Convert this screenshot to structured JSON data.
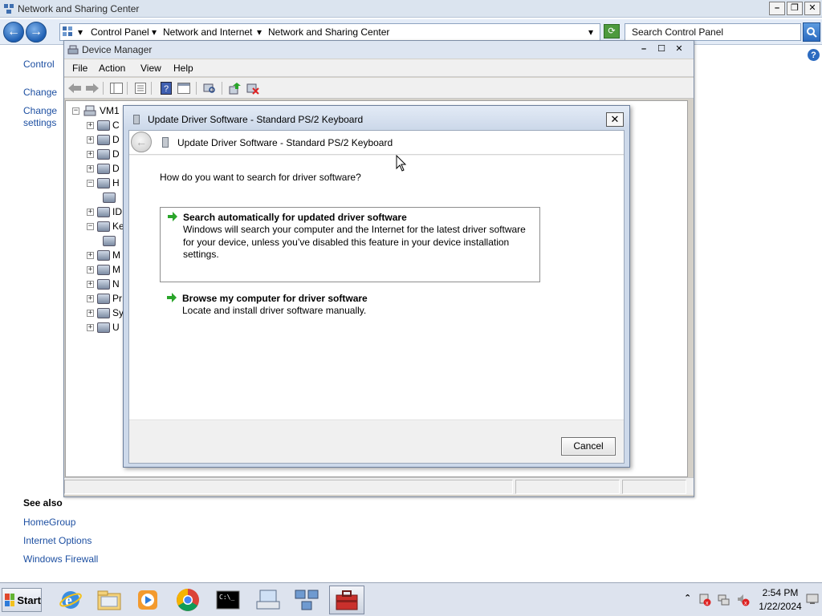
{
  "background_window": {
    "title": "Network and Sharing Center",
    "address_crumbs": [
      "Control Panel",
      "Network and Internet",
      "Network and Sharing Center"
    ],
    "search_placeholder": "Search Control Panel",
    "left_links": [
      "Control",
      "Change",
      "Change",
      "settings"
    ],
    "see_also_title": "See also",
    "see_also_links": [
      "HomeGroup",
      "Internet Options",
      "Windows Firewall"
    ]
  },
  "device_manager": {
    "title": "Device Manager",
    "menu": [
      "File",
      "Action",
      "View",
      "Help"
    ],
    "tree_root": "VM1",
    "tree_items": [
      {
        "label": "C",
        "expander": "+"
      },
      {
        "label": "D",
        "expander": "+"
      },
      {
        "label": "D",
        "expander": "+"
      },
      {
        "label": "D",
        "expander": "+"
      },
      {
        "label": "H",
        "expander": "-"
      },
      {
        "label": "",
        "expander": ""
      },
      {
        "label": "ID",
        "expander": "+"
      },
      {
        "label": "Ke",
        "expander": "-"
      },
      {
        "label": "",
        "expander": ""
      },
      {
        "label": "M",
        "expander": "+"
      },
      {
        "label": "M",
        "expander": "+"
      },
      {
        "label": "N",
        "expander": "+"
      },
      {
        "label": "Pr",
        "expander": "+"
      },
      {
        "label": "Sy",
        "expander": "+"
      },
      {
        "label": "U",
        "expander": "+"
      }
    ]
  },
  "update_dialog": {
    "title": "Update Driver Software - Standard PS/2 Keyboard",
    "header_title": "Update Driver Software - Standard PS/2 Keyboard",
    "question": "How do you want to search for driver software?",
    "options": [
      {
        "title": "Search automatically for updated driver software",
        "description": "Windows will search your computer and the Internet for the latest driver software for your device, unless you’ve disabled this feature in your device installation settings."
      },
      {
        "title": "Browse my computer for driver software",
        "description": "Locate and install driver software manually."
      }
    ],
    "cancel_label": "Cancel"
  },
  "taskbar": {
    "start_label": "Start",
    "apps": [
      "internet-explorer-icon",
      "windows-explorer-icon",
      "media-player-icon",
      "chrome-icon",
      "command-prompt-icon",
      "keyboard-settings-icon",
      "network-icon",
      "device-manager-toolbox-icon"
    ],
    "clock_time": "2:54 PM",
    "clock_date": "1/22/2024"
  },
  "colors": {
    "link": "#1e50a2",
    "dialog_frame": "#cdd9ea",
    "arrow_green": "#2aa52a"
  }
}
